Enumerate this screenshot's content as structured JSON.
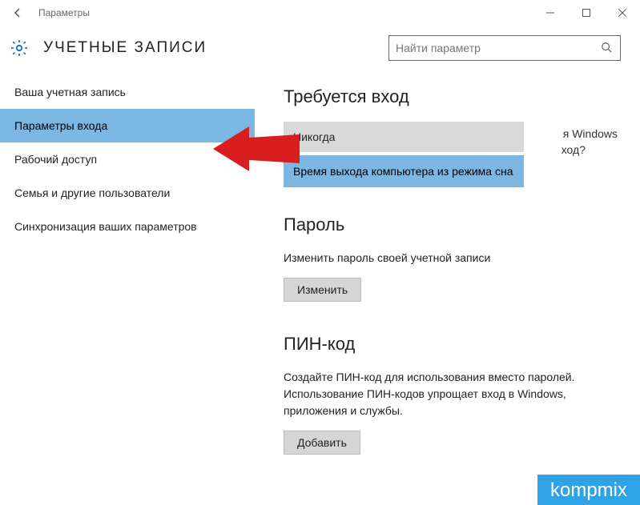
{
  "window": {
    "caption": "Параметры"
  },
  "header": {
    "title": "УЧЕТНЫЕ ЗАПИСИ"
  },
  "search": {
    "placeholder": "Найти параметр"
  },
  "sidebar": {
    "items": [
      {
        "label": "Ваша учетная запись"
      },
      {
        "label": "Параметры входа"
      },
      {
        "label": "Рабочий доступ"
      },
      {
        "label": "Семья и другие пользователи"
      },
      {
        "label": "Синхронизация ваших параметров"
      }
    ],
    "active_index": 1
  },
  "content": {
    "signin": {
      "heading": "Требуется вход",
      "bg_frag1": "я Windows",
      "bg_frag2": "ход?",
      "dd_selected": "Никогда",
      "dd_option": "Время выхода компьютера из режима сна"
    },
    "password": {
      "heading": "Пароль",
      "desc": "Изменить пароль своей учетной записи",
      "button": "Изменить"
    },
    "pin": {
      "heading": "ПИН-код",
      "desc": "Создайте ПИН-код для использования вместо паролей. Использование ПИН-кодов упрощает вход в Windows, приложения и службы.",
      "button": "Добавить"
    }
  },
  "watermark": {
    "text": "kompmix"
  }
}
